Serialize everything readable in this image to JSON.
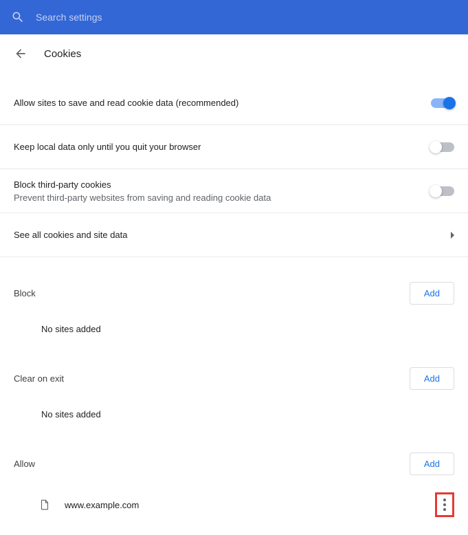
{
  "header": {
    "search_placeholder": "Search settings"
  },
  "title_bar": {
    "title": "Cookies"
  },
  "settings": [
    {
      "label": "Allow sites to save and read cookie data (recommended)",
      "sublabel": "",
      "toggle": "on"
    },
    {
      "label": "Keep local data only until you quit your browser",
      "sublabel": "",
      "toggle": "off"
    },
    {
      "label": "Block third-party cookies",
      "sublabel": "Prevent third-party websites from saving and reading cookie data",
      "toggle": "off"
    },
    {
      "label": "See all cookies and site data",
      "type": "link"
    }
  ],
  "sections": {
    "block": {
      "title": "Block",
      "add_label": "Add",
      "empty_text": "No sites added",
      "sites": []
    },
    "clear": {
      "title": "Clear on exit",
      "add_label": "Add",
      "empty_text": "No sites added",
      "sites": []
    },
    "allow": {
      "title": "Allow",
      "add_label": "Add",
      "sites": [
        {
          "url": "www.example.com"
        }
      ]
    }
  }
}
